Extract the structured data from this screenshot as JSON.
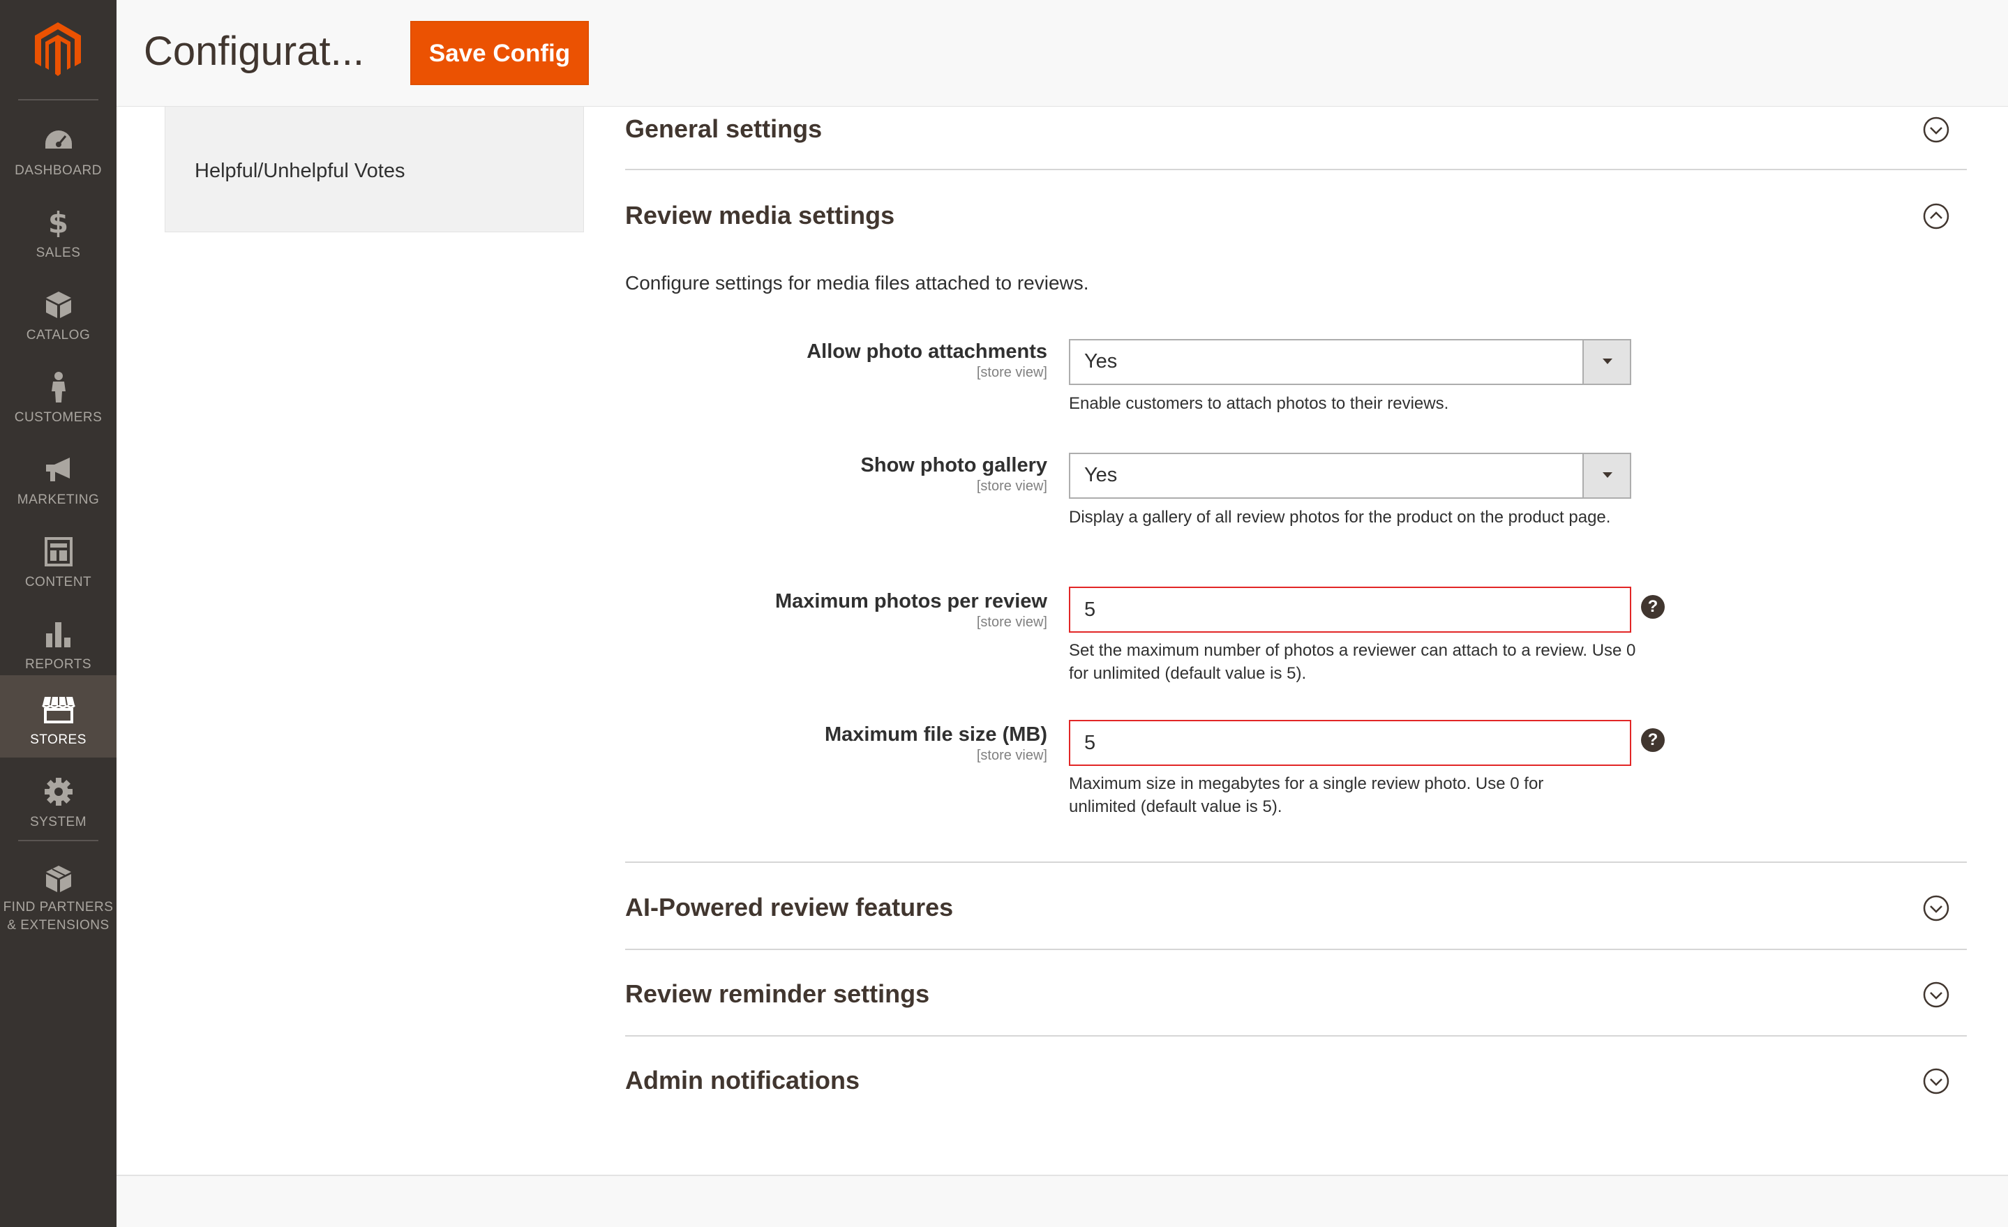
{
  "menu": {
    "items": [
      {
        "label": "DASHBOARD",
        "icon": "dashboard-icon"
      },
      {
        "label": "SALES",
        "icon": "dollar-icon"
      },
      {
        "label": "CATALOG",
        "icon": "cube-icon"
      },
      {
        "label": "CUSTOMERS",
        "icon": "person-icon"
      },
      {
        "label": "MARKETING",
        "icon": "megaphone-icon"
      },
      {
        "label": "CONTENT",
        "icon": "layout-icon"
      },
      {
        "label": "REPORTS",
        "icon": "bar-chart-icon"
      },
      {
        "label": "STORES",
        "icon": "storefront-icon",
        "active": true
      },
      {
        "label": "SYSTEM",
        "icon": "gear-icon"
      },
      {
        "label_line1": "FIND PARTNERS",
        "label_line2": "& EXTENSIONS",
        "icon": "boxes-icon"
      }
    ]
  },
  "header": {
    "title": "Configurat...",
    "save_label": "Save Config"
  },
  "config_tabs": {
    "active_item": "Helpful/Unhelpful Votes"
  },
  "sections": {
    "general": {
      "title": "General settings",
      "state": "collapsed"
    },
    "media": {
      "title": "Review media settings",
      "state": "expanded",
      "description": "Configure settings for media files attached to reviews.",
      "fields": {
        "allow_photos": {
          "label": "Allow photo attachments",
          "scope": "[store view]",
          "value": "Yes",
          "note": "Enable customers to attach photos to their reviews."
        },
        "show_gallery": {
          "label": "Show photo gallery",
          "scope": "[store view]",
          "value": "Yes",
          "note": "Display a gallery of all review photos for the product on the product page."
        },
        "max_photos": {
          "label": "Maximum photos per review",
          "scope": "[store view]",
          "value": "5",
          "help": "?",
          "note": "Set the maximum number of photos a reviewer can attach to a review. Use 0 for unlimited (default value is 5)."
        },
        "max_file_size": {
          "label": "Maximum file size (MB)",
          "scope": "[store view]",
          "value": "5",
          "help": "?",
          "note": "Maximum size in megabytes for a single review photo. Use 0 for unlimited (default value is 5)."
        }
      }
    },
    "ai": {
      "title": "AI-Powered review features",
      "state": "collapsed"
    },
    "reminder": {
      "title": "Review reminder settings",
      "state": "collapsed"
    },
    "admin": {
      "title": "Admin notifications",
      "state": "collapsed"
    }
  },
  "colors": {
    "menu_bg": "#373330",
    "menu_active_bg": "#514943",
    "accent": "#eb5202",
    "error_border": "#e22626",
    "heading": "#41362f"
  }
}
